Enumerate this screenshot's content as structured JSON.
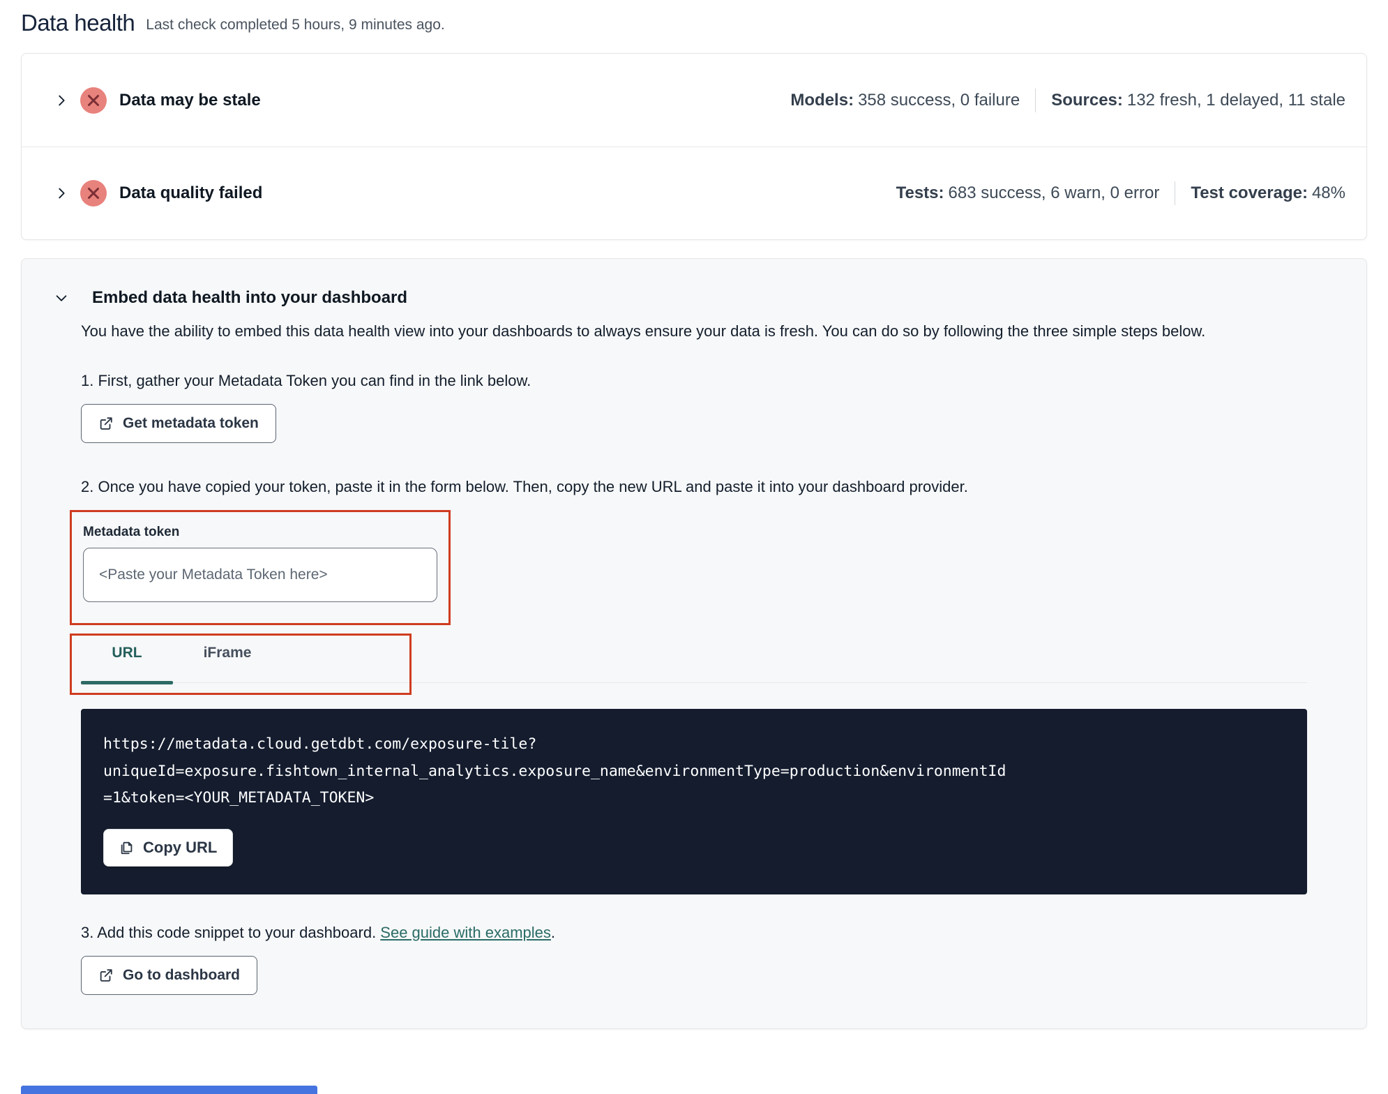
{
  "header": {
    "title": "Data health",
    "subtitle": "Last check completed 5 hours, 9 minutes ago."
  },
  "status_rows": [
    {
      "label": "Data may be stale",
      "stats": [
        {
          "k": "Models:",
          "v": "358 success, 0 failure"
        },
        {
          "k": "Sources:",
          "v": "132 fresh, 1 delayed, 11 stale"
        }
      ]
    },
    {
      "label": "Data quality failed",
      "stats": [
        {
          "k": "Tests:",
          "v": "683 success, 6 warn, 0 error"
        },
        {
          "k": "Test coverage:",
          "v": "48%"
        }
      ]
    }
  ],
  "embed": {
    "title": "Embed data health into your dashboard",
    "description": "You have the ability to embed this data health view into your dashboards to always ensure your data is fresh. You can do so by following the three simple steps below.",
    "step1": "1. First, gather your Metadata Token you can find in the link below.",
    "get_token_button": "Get metadata token",
    "step2": "2. Once you have copied your token, paste it in the form below. Then, copy the new URL and paste it into your dashboard provider.",
    "token_label": "Metadata token",
    "token_placeholder": "<Paste your Metadata Token here>",
    "tabs": {
      "url": "URL",
      "iframe": "iFrame"
    },
    "embed_url": "https://metadata.cloud.getdbt.com/exposure-tile?uniqueId=exposure.fishtown_internal_analytics.exposure_name&environmentType=production&environmentId=1&token=<YOUR_METADATA_TOKEN>",
    "copy_url_button": "Copy URL",
    "step3_prefix": "3. Add this code snippet to your dashboard. ",
    "step3_link": "See guide with examples",
    "step3_suffix": ".",
    "dashboard_button": "Go to dashboard"
  },
  "colors": {
    "error_icon_bg": "#e8827c",
    "error_icon_fg": "#7b2e35",
    "highlight_box": "#cf3c20",
    "active_tab_teal": "#2d6a65",
    "link_teal": "#2a6b66",
    "code_block_bg": "#141c2e",
    "bottom_bar_blue": "#4573e0"
  },
  "icons": {
    "chevron_right": "chevron-right-icon",
    "chevron_down": "chevron-down-icon",
    "error_x": "x-circle-icon",
    "external_link": "external-link-icon",
    "copy": "copy-icon"
  }
}
